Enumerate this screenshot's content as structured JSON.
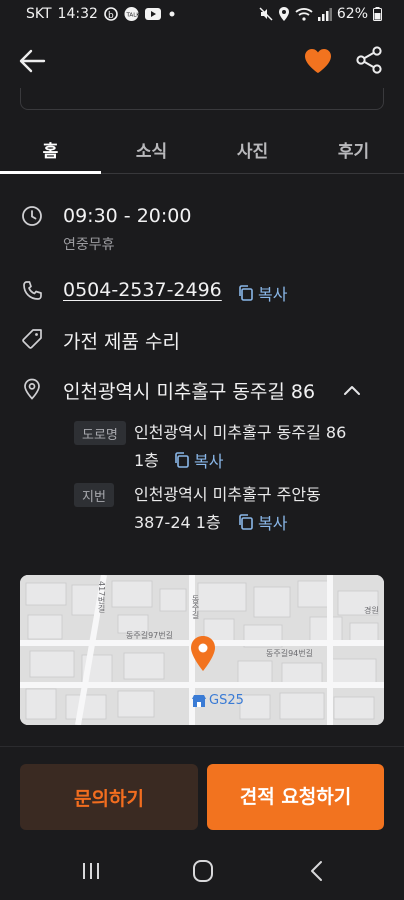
{
  "status_bar": {
    "carrier": "SKT",
    "time": "14:32",
    "battery": "62%",
    "left_icons": [
      "b-app-icon",
      "talk-app-icon",
      "youtube-icon",
      "dot-icon"
    ],
    "right_icons": [
      "mute-icon",
      "location-icon",
      "wifi-icon",
      "signal-icon",
      "battery-icon"
    ]
  },
  "header": {
    "back_icon": "arrow-left-icon",
    "favorite_icon": "heart-icon",
    "share_icon": "share-icon",
    "accent_color": "#f2731f"
  },
  "tabs": [
    {
      "label": "홈",
      "active": true
    },
    {
      "label": "소식",
      "active": false
    },
    {
      "label": "사진",
      "active": false
    },
    {
      "label": "후기",
      "active": false
    }
  ],
  "info": {
    "hours": "09:30 - 20:00",
    "hours_note": "연중무휴",
    "phone": "0504-2537-2496",
    "copy_label": "복사",
    "category": "가전 제품 수리",
    "address": "인천광역시 미추홀구 동주길 86",
    "road_tag": "도로명",
    "road_line1": "인천광역시 미추홀구 동주길 86",
    "road_line2": "1층",
    "lot_tag": "지번",
    "lot_line1": "인천광역시 미추홀구 주안동",
    "lot_line2": "387-24 1층"
  },
  "map": {
    "labels": [
      "동주길97번길",
      "동주길94번길",
      "동주길",
      "경원",
      "417번길"
    ],
    "poi": "GS25"
  },
  "actions": {
    "inquiry": "문의하기",
    "quote": "견적 요청하기"
  }
}
